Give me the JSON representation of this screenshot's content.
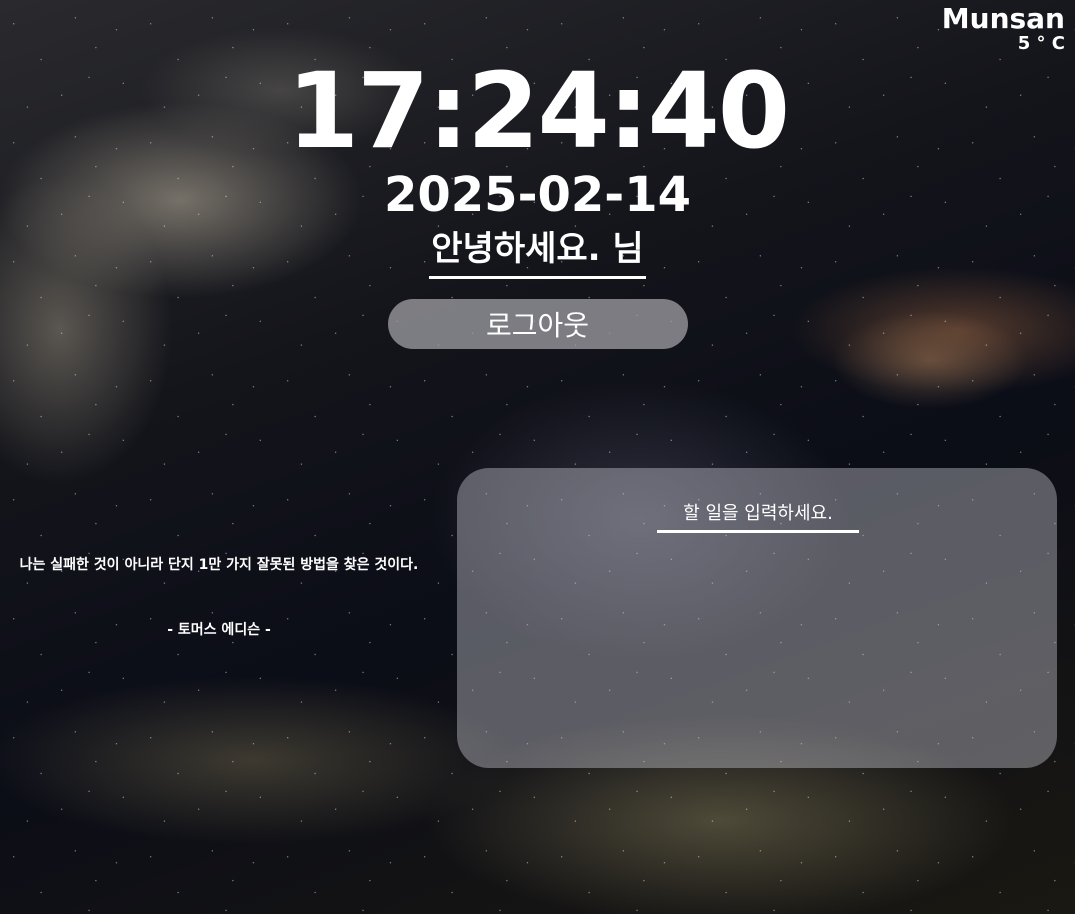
{
  "weather": {
    "city": "Munsan",
    "temperature": "5 ° C"
  },
  "clock": {
    "time": "17:24:40",
    "date": "2025-02-14"
  },
  "greeting": {
    "text": "안녕하세요. 님"
  },
  "logout": {
    "label": "로그아웃"
  },
  "quote": {
    "text": "나는 실패한 것이 아니라 단지 1만 가지 잘못된 방법을 찾은 것이다.",
    "author": "- 토머스 에디슨 -"
  },
  "todo": {
    "placeholder": "할 일을 입력하세요."
  }
}
